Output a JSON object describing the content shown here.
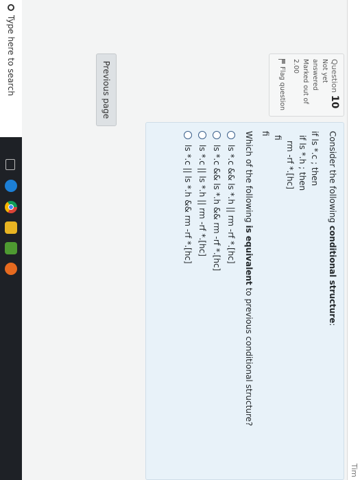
{
  "topbar": {
    "right_fragment": "Tim"
  },
  "question_info": {
    "label": "Question",
    "number": "10",
    "status_line1": "Not yet",
    "status_line2": "answered",
    "marked_line1": "Marked out of",
    "marked_value": "2.00",
    "flag_label": "Flag question"
  },
  "question": {
    "intro": "Consider the following ",
    "intro_bold": "conditional structure",
    "intro_end": ":",
    "code": [
      "if ls *.c ; then",
      "if ls *.h ; then",
      "rm -rf *.[hc]",
      "fi",
      "fi"
    ],
    "prompt_start": "Which of the following ",
    "prompt_bold": "is equivalent",
    "prompt_end": " to previous conditional structure?",
    "options": [
      "ls *.c && ls *.h || rm -rf *.[hc]",
      "ls *.c && ls *.h && rm -rf *.[hc]",
      "ls *.c || ls *.h || rm -rf *.[hc]",
      "ls *.c || ls *.h && rm -rf *.[hc]"
    ]
  },
  "navigation": {
    "previous_label": "Previous page"
  },
  "taskbar": {
    "search_text": "Type here to search",
    "icons": [
      "task-view-icon",
      "edge-icon",
      "chrome-icon",
      "file-explorer-icon",
      "store-icon",
      "firefox-icon"
    ],
    "colors": {
      "edge": "#1c7fd6",
      "files": "#e8b422",
      "store": "#4e9a31",
      "firefox": "#e66a1f"
    }
  }
}
